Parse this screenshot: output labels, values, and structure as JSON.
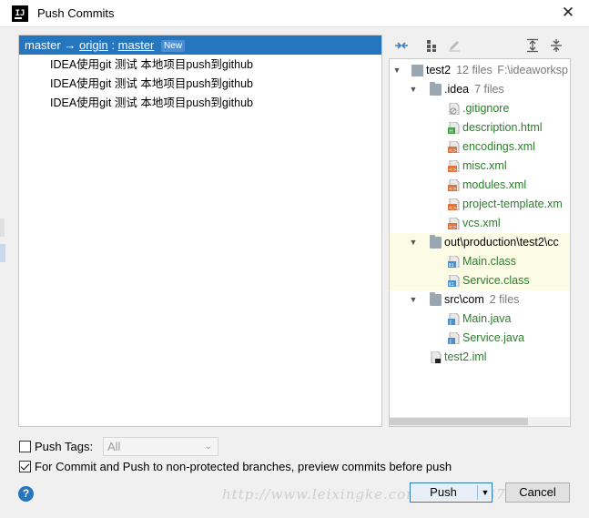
{
  "window": {
    "title": "Push Commits",
    "app_icon_text": "IJ",
    "close_glyph": "✕"
  },
  "branch": {
    "local": "master",
    "arrow": "→",
    "remote": "origin",
    "separator": ":",
    "remote_branch": "master",
    "badge": "New"
  },
  "commits": [
    "IDEA使用git 测试 本地项目push到github",
    "IDEA使用git 测试 本地项目push到github",
    "IDEA使用git 测试 本地项目push到github"
  ],
  "tree": {
    "root": {
      "name": "test2",
      "count": "12 files",
      "path": "F:\\ideaworksp"
    },
    "idea_folder": {
      "name": ".idea",
      "count": "7 files"
    },
    "idea_files": [
      {
        "name": ".gitignore",
        "icon": "gitignore-file-icon"
      },
      {
        "name": "description.html",
        "icon": "html-file-icon"
      },
      {
        "name": "encodings.xml",
        "icon": "xml-file-icon"
      },
      {
        "name": "misc.xml",
        "icon": "xml-file-icon"
      },
      {
        "name": "modules.xml",
        "icon": "xml-file-icon"
      },
      {
        "name": "project-template.xm",
        "icon": "xml-file-icon"
      },
      {
        "name": "vcs.xml",
        "icon": "xml-file-icon"
      }
    ],
    "out_folder": {
      "name": "out\\production\\test2\\cc"
    },
    "out_files": [
      {
        "name": "Main.class",
        "icon": "class-file-icon"
      },
      {
        "name": "Service.class",
        "icon": "class-file-icon"
      }
    ],
    "src_folder": {
      "name": "src\\com",
      "count": "2 files"
    },
    "src_files": [
      {
        "name": "Main.java",
        "icon": "java-file-icon"
      },
      {
        "name": "Service.java",
        "icon": "java-file-icon"
      }
    ],
    "iml_file": {
      "name": "test2.iml",
      "icon": "iml-file-icon"
    }
  },
  "options": {
    "push_tags_label": "Push Tags:",
    "push_tags_checked": false,
    "push_tags_select": "All",
    "preview_label": "For Commit and Push to non-protected branches, preview commits before push",
    "preview_checked": true
  },
  "buttons": {
    "help": "?",
    "push": "Push",
    "cancel": "Cancel"
  },
  "watermark": "http://www.leixingke.com/qq_35                237",
  "colors": {
    "selection": "#2675bf",
    "file_added": "#2d7d2d",
    "highlight_row": "#fcfce6"
  }
}
